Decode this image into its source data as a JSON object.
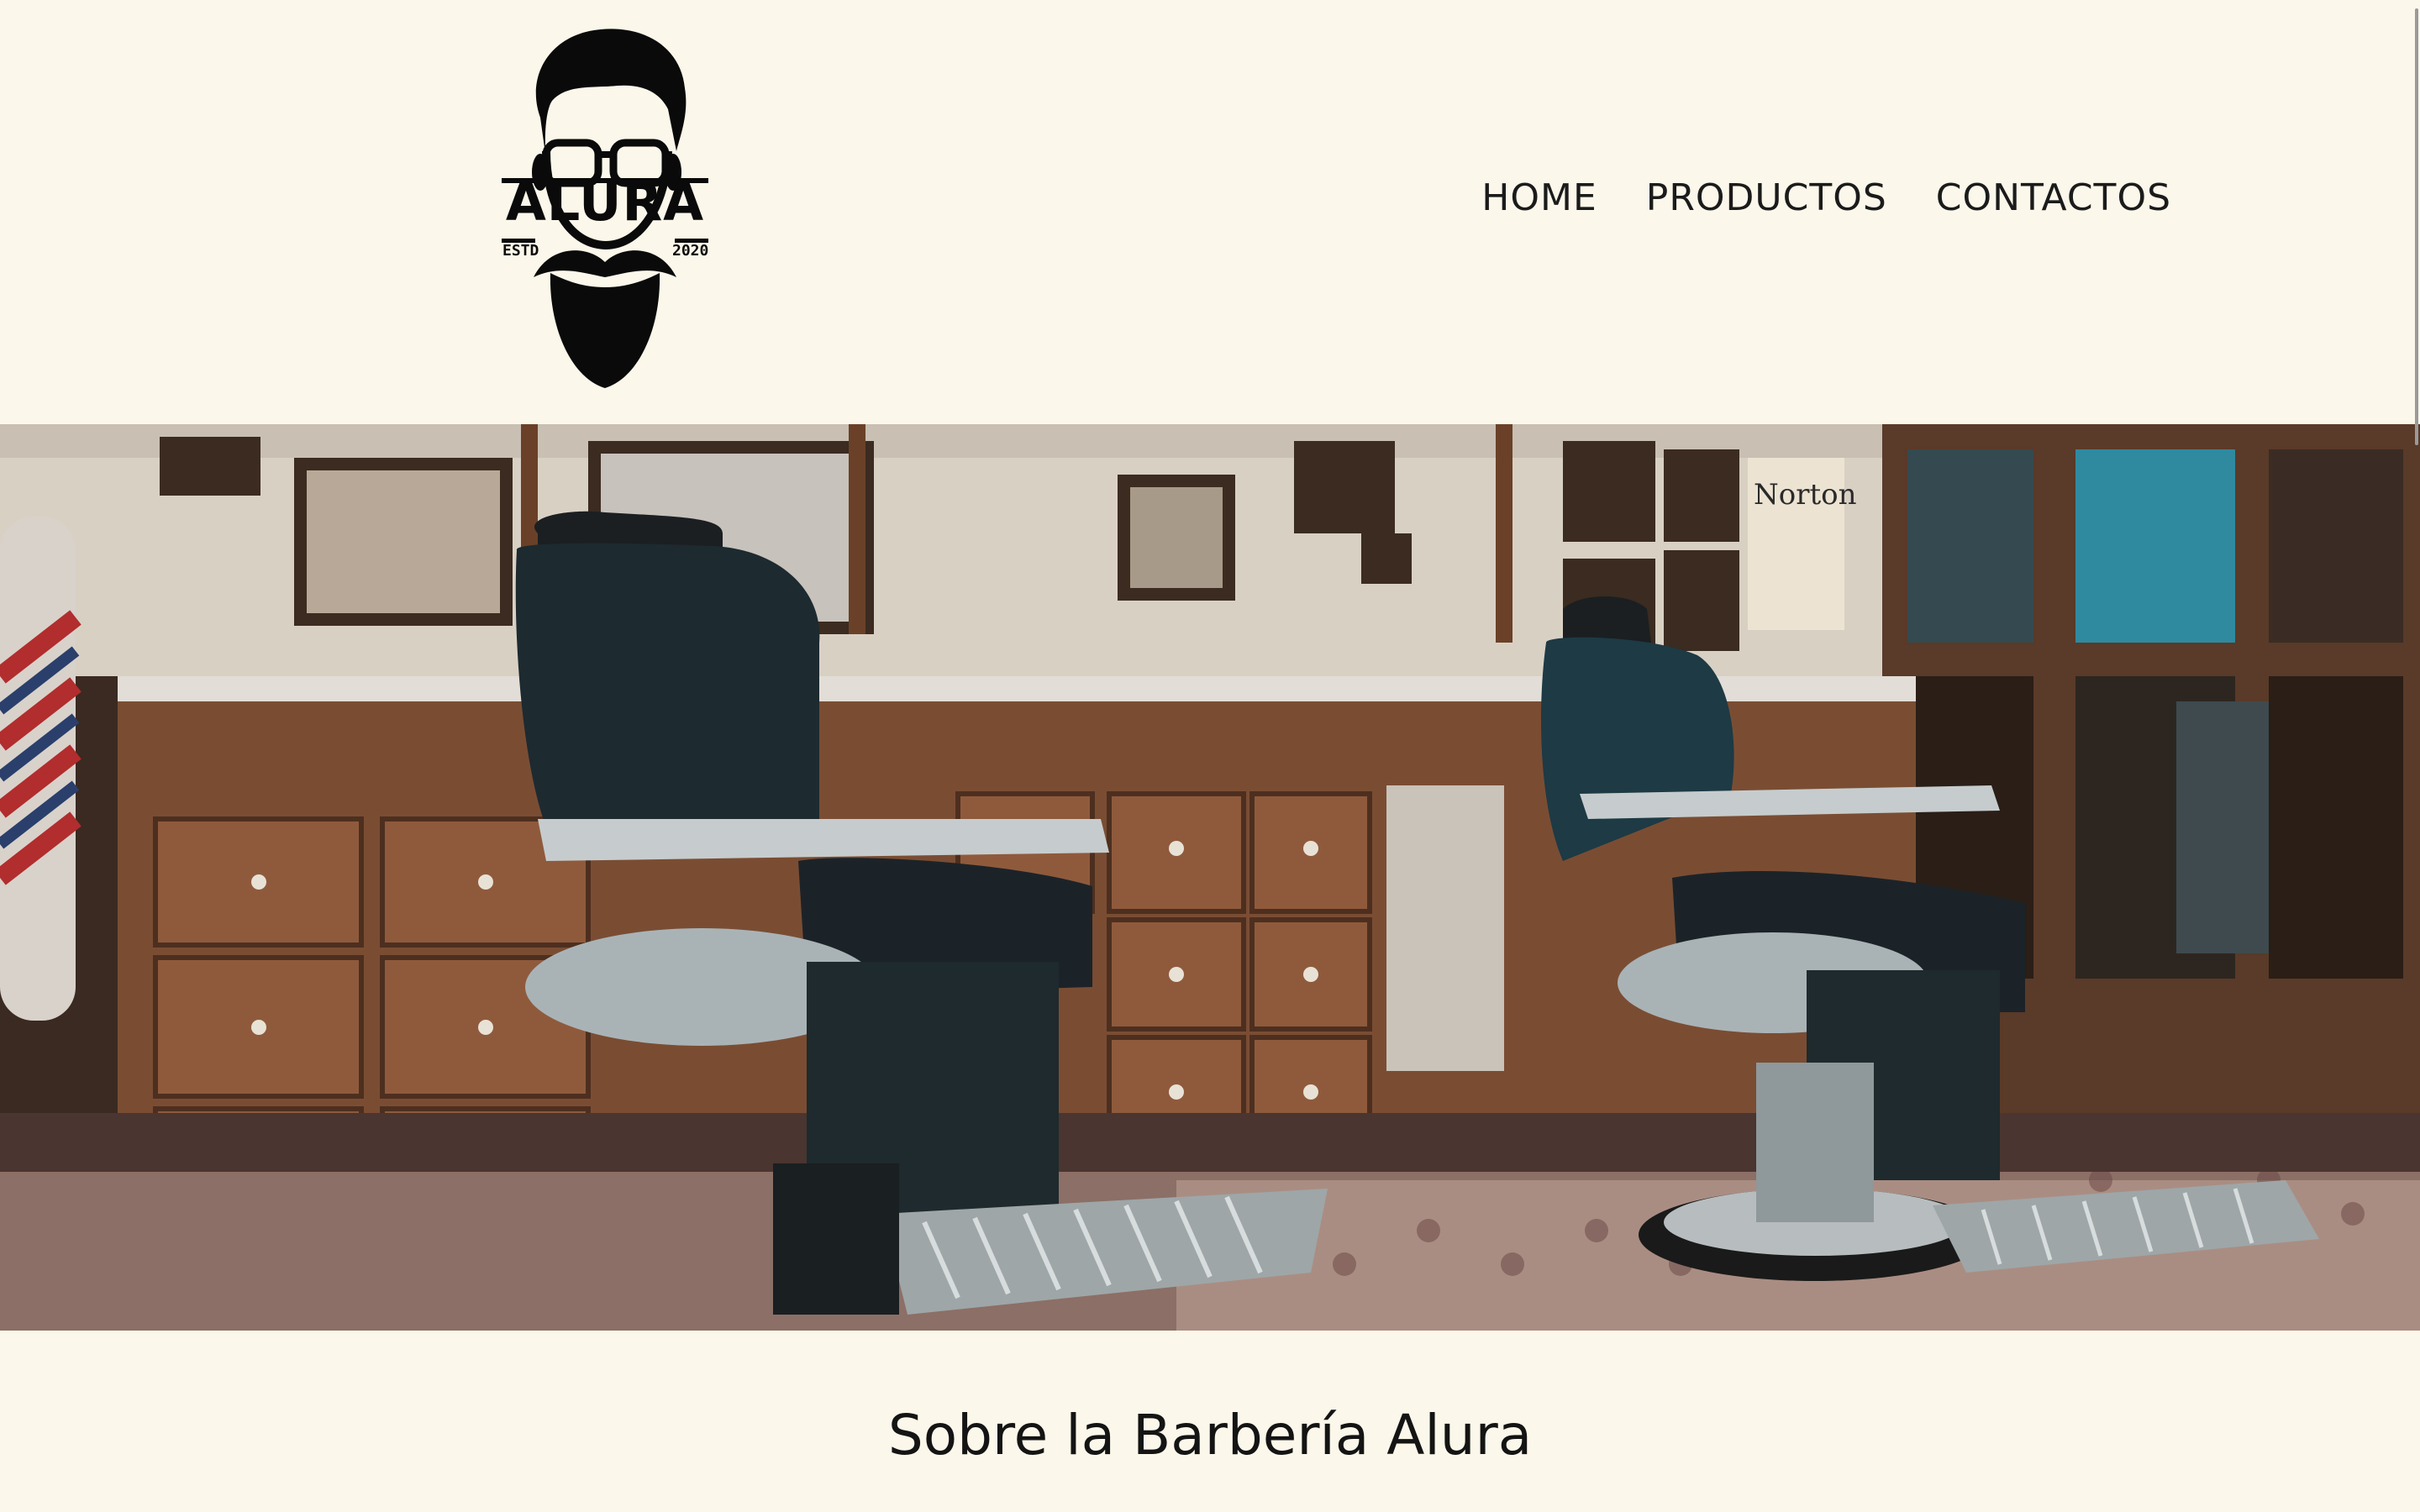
{
  "brand": {
    "name": "ALURA",
    "estd_label": "ESTD",
    "year": "2020"
  },
  "nav": {
    "items": [
      {
        "label": "HOME"
      },
      {
        "label": "PRODUCTOS"
      },
      {
        "label": "CONTACTOS"
      }
    ]
  },
  "hero": {
    "icon": "barbershop-interior-photo",
    "sign_text": "Norton"
  },
  "about": {
    "title": "Sobre la Barbería Alura"
  },
  "colors": {
    "background": "#fbf7ea",
    "text": "#1b1b1b"
  }
}
